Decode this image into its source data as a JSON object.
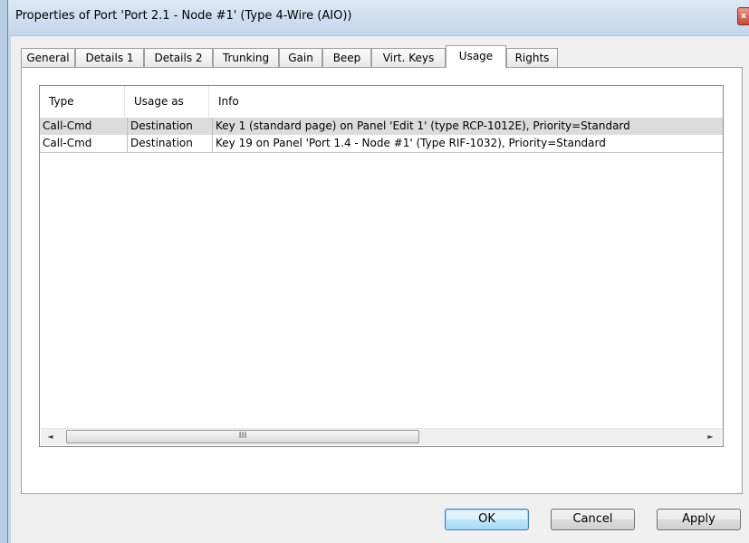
{
  "window": {
    "title": "Properties of Port 'Port 2.1 - Node #1' (Type 4-Wire (AIO))"
  },
  "tabs": [
    {
      "label": "General"
    },
    {
      "label": "Details 1"
    },
    {
      "label": "Details 2"
    },
    {
      "label": "Trunking"
    },
    {
      "label": "Gain"
    },
    {
      "label": "Beep"
    },
    {
      "label": "Virt. Keys"
    },
    {
      "label": "Usage",
      "active": true
    },
    {
      "label": "Rights"
    }
  ],
  "usage_list": {
    "columns": [
      "Type",
      "Usage as",
      "Info"
    ],
    "rows": [
      {
        "type": "Call-Cmd",
        "usage": "Destination",
        "info": "Key 1 (standard page) on Panel 'Edit 1' (type RCP-1012E), Priority=Standard"
      },
      {
        "type": "Call-Cmd",
        "usage": "Destination",
        "info": "Key 19 on Panel 'Port 1.4 - Node #1' (Type RIF-1032), Priority=Standard"
      }
    ],
    "scrollbar": {
      "left_arrow": "◄",
      "right_arrow": "►",
      "grip": "III"
    }
  },
  "buttons": {
    "ok": "OK",
    "cancel": "Cancel",
    "apply": "Apply"
  },
  "icons": {
    "close": "close-icon"
  }
}
